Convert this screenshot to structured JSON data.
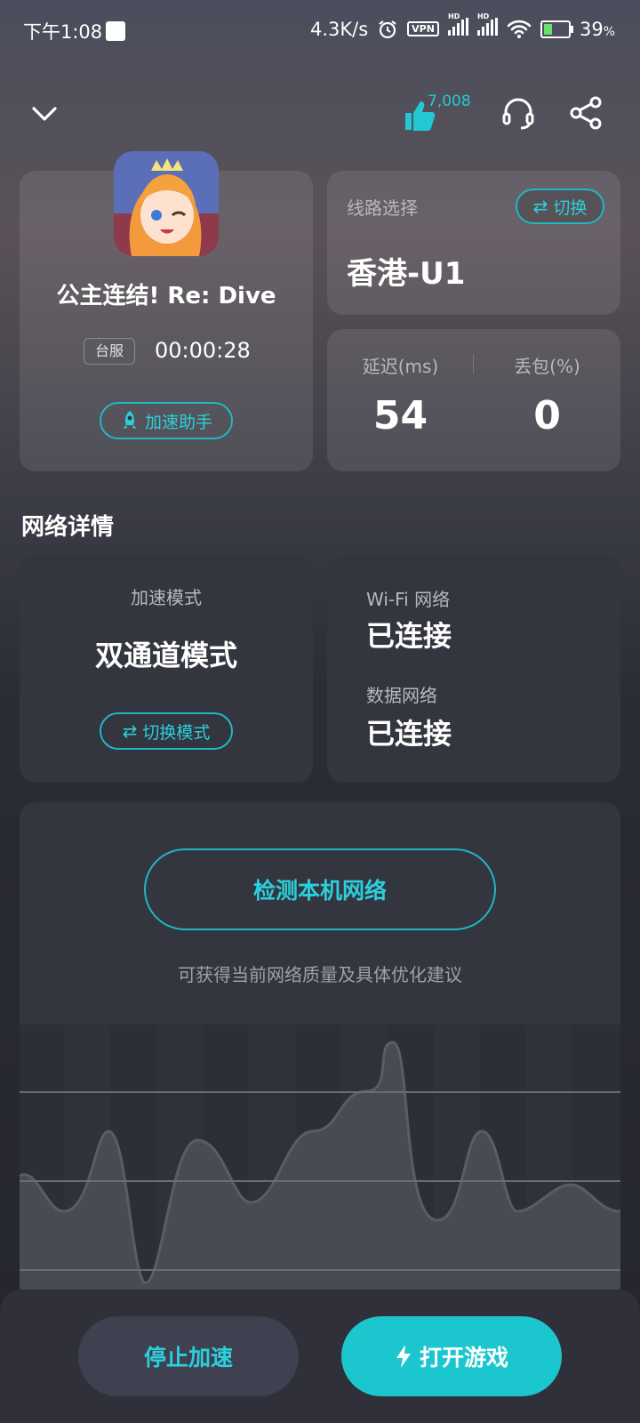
{
  "status_bar": {
    "time": "下午1:08",
    "speed": "4.3K/s",
    "vpn": "VPN",
    "hd1": "HD",
    "hd2": "HD",
    "battery": "39",
    "battery_unit": "%"
  },
  "header": {
    "likes": "7,008"
  },
  "game": {
    "title": "公主连结! Re: Dive",
    "server_badge": "台服",
    "timer": "00:00:28",
    "assistant_label": "加速助手"
  },
  "route": {
    "label": "线路选择",
    "switch_label": "切换",
    "value": "香港-U1"
  },
  "stats": {
    "latency_label": "延迟(ms)",
    "latency_value": "54",
    "loss_label": "丢包(%)",
    "loss_value": "0"
  },
  "network": {
    "section_title": "网络详情",
    "mode_label": "加速模式",
    "mode_value": "双通道模式",
    "mode_switch_label": "切换模式",
    "wifi_label": "Wi-Fi 网络",
    "wifi_value": "已连接",
    "data_label": "数据网络",
    "data_value": "已连接"
  },
  "detect": {
    "button_label": "检测本机网络",
    "hint": "可获得当前网络质量及具体优化建议"
  },
  "bottom": {
    "stop_label": "停止加速",
    "open_label": "打开游戏"
  },
  "colors": {
    "accent": "#22c9d4",
    "primary_button": "#1cc6ce",
    "card": "#33353f"
  }
}
